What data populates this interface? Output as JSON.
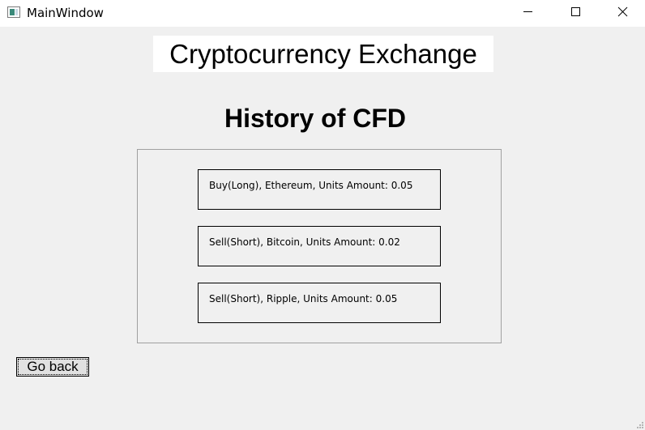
{
  "window": {
    "title": "MainWindow"
  },
  "header": {
    "app_name": "Cryptocurrency Exchange"
  },
  "main": {
    "page_title": "History of CFD",
    "history": [
      {
        "label": "Buy(Long), Ethereum, Units Amount: 0.05"
      },
      {
        "label": "Sell(Short), Bitcoin, Units Amount: 0.02"
      },
      {
        "label": "Sell(Short), Ripple, Units Amount: 0.05"
      }
    ],
    "go_back_label": "Go back"
  },
  "icons": {
    "app": "window-icon",
    "minimize": "minimize-icon",
    "maximize": "maximize-icon",
    "close": "close-icon",
    "resize": "resize-grip-icon"
  }
}
